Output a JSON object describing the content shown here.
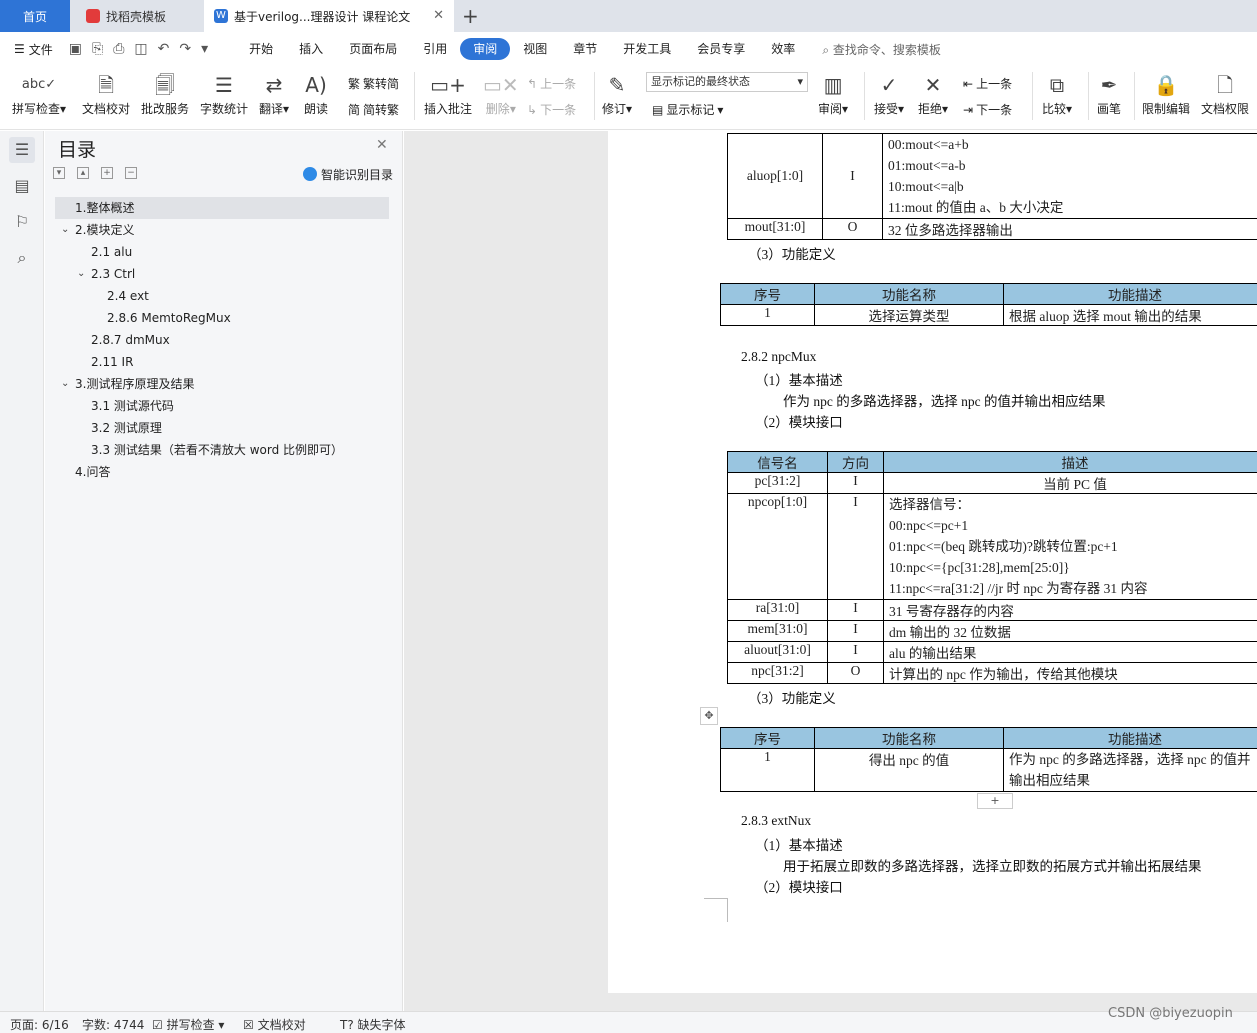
{
  "tabs": {
    "home": "首页",
    "doc1": "找稻壳模板",
    "doc2": "基于verilog...理器设计 课程论文",
    "doc2_icon": "W"
  },
  "menubar": {
    "file": "文件",
    "tabs": [
      "开始",
      "插入",
      "页面布局",
      "引用",
      "审阅",
      "视图",
      "章节",
      "开发工具",
      "会员专享",
      "效率"
    ],
    "active_tab": "审阅",
    "search": "查找命令、搜索模板"
  },
  "ribbon": {
    "spell_check": "拼写检查",
    "doc_proof": "文档校对",
    "review_service": "批改服务",
    "word_count": "字数统计",
    "translate": "翻译",
    "read_aloud": "朗读",
    "trad_to_simp": "繁转简",
    "simp_to_trad": "简转繁",
    "insert_comment": "插入批注",
    "delete": "删除",
    "prev_comment": "上一条",
    "next_comment": "下一条",
    "track_changes": "修订",
    "markup_state": "显示标记的最终状态",
    "show_markup": "显示标记",
    "review": "审阅",
    "accept": "接受",
    "reject": "拒绝",
    "prev_change": "上一条",
    "next_change": "下一条",
    "compare": "比较",
    "pen": "画笔",
    "restrict_edit": "限制编辑",
    "doc_permission": "文档权限"
  },
  "toc": {
    "title": "目录",
    "smart_identify": "智能识别目录",
    "items": [
      {
        "label": "1.整体概述",
        "level": 1,
        "selected": true,
        "expand": ""
      },
      {
        "label": "2.模块定义",
        "level": 1,
        "expand": "open"
      },
      {
        "label": "2.1 alu",
        "level": 2,
        "expand": ""
      },
      {
        "label": "2.3 Ctrl",
        "level": 2,
        "expand": "open"
      },
      {
        "label": "2.4 ext",
        "level": 3,
        "expand": ""
      },
      {
        "label": "2.8.6 MemtoRegMux",
        "level": 3,
        "expand": ""
      },
      {
        "label": "2.8.7 dmMux",
        "level": 2,
        "expand": ""
      },
      {
        "label": "2.11 IR",
        "level": 2,
        "expand": ""
      },
      {
        "label": "3.测试程序原理及结果",
        "level": 1,
        "expand": "open"
      },
      {
        "label": "3.1 测试源代码",
        "level": 2,
        "expand": ""
      },
      {
        "label": "3.2 测试原理",
        "level": 2,
        "expand": ""
      },
      {
        "label": "3.3 测试结果（若看不清放大 word 比例即可）",
        "level": 2,
        "expand": ""
      },
      {
        "label": "4.问答",
        "level": 1,
        "expand": ""
      }
    ]
  },
  "doc": {
    "t1": {
      "rows": [
        {
          "name": "aluop[1:0]",
          "dir": "I",
          "desc": [
            "00:mout<=a+b",
            "01:mout<=a-b",
            "10:mout<=a|b",
            "11:mout 的值由 a、b 大小决定"
          ]
        },
        {
          "name": "mout[31:0]",
          "dir": "O",
          "desc": [
            "32 位多路选择器输出"
          ]
        }
      ]
    },
    "func_def_1": "（3）功能定义",
    "t2": {
      "headers": [
        "序号",
        "功能名称",
        "功能描述"
      ],
      "rows": [
        [
          "1",
          "选择运算类型",
          "根据 aluop 选择 mout 输出的结果"
        ]
      ]
    },
    "sec_282": "2.8.2 npcMux",
    "basic_desc_1": "（1）基本描述",
    "desc_npc": "作为 npc 的多路选择器，选择 npc 的值并输出相应结果",
    "module_port_1": "（2）模块接口",
    "t3": {
      "headers": [
        "信号名",
        "方向",
        "描述"
      ],
      "rows": [
        {
          "name": "pc[31:2]",
          "dir": "I",
          "desc": [
            "当前 PC 值"
          ],
          "center": true
        },
        {
          "name": "npcop[1:0]",
          "dir": "I",
          "desc": [
            "选择器信号：",
            "00:npc<=pc+1",
            "01:npc<=(beq 跳转成功)?跳转位置:pc+1",
            "10:npc<={pc[31:28],mem[25:0]}",
            "11:npc<=ra[31:2] //jr 时 npc 为寄存器 31 内容"
          ]
        },
        {
          "name": "ra[31:0]",
          "dir": "I",
          "desc": [
            "31 号寄存器存的内容"
          ]
        },
        {
          "name": "mem[31:0]",
          "dir": "I",
          "desc": [
            "dm 输出的 32 位数据"
          ]
        },
        {
          "name": "aluout[31:0]",
          "dir": "I",
          "desc": [
            "alu 的输出结果"
          ]
        },
        {
          "name": "npc[31:2]",
          "dir": "O",
          "desc": [
            "计算出的 npc 作为输出，传给其他模块"
          ]
        }
      ]
    },
    "func_def_2": "（3）功能定义",
    "t4": {
      "headers": [
        "序号",
        "功能名称",
        "功能描述"
      ],
      "rows": [
        [
          "1",
          "得出 npc 的值",
          "作为 npc 的多路选择器，选择 npc 的值并",
          "输出相应结果"
        ]
      ]
    },
    "sec_283": "2.8.3 extNux",
    "basic_desc_2": "（1）基本描述",
    "desc_ext": "用于拓展立即数的多路选择器，选择立即数的拓展方式并输出拓展结果",
    "module_port_2": "（2）模块接口"
  },
  "status": {
    "page": "页面: 6/16",
    "words": "字数: 4744",
    "spell": "拼写检查",
    "proof": "文档校对",
    "missing_font": "缺失字体"
  },
  "watermark": "CSDN @biyezuopin"
}
